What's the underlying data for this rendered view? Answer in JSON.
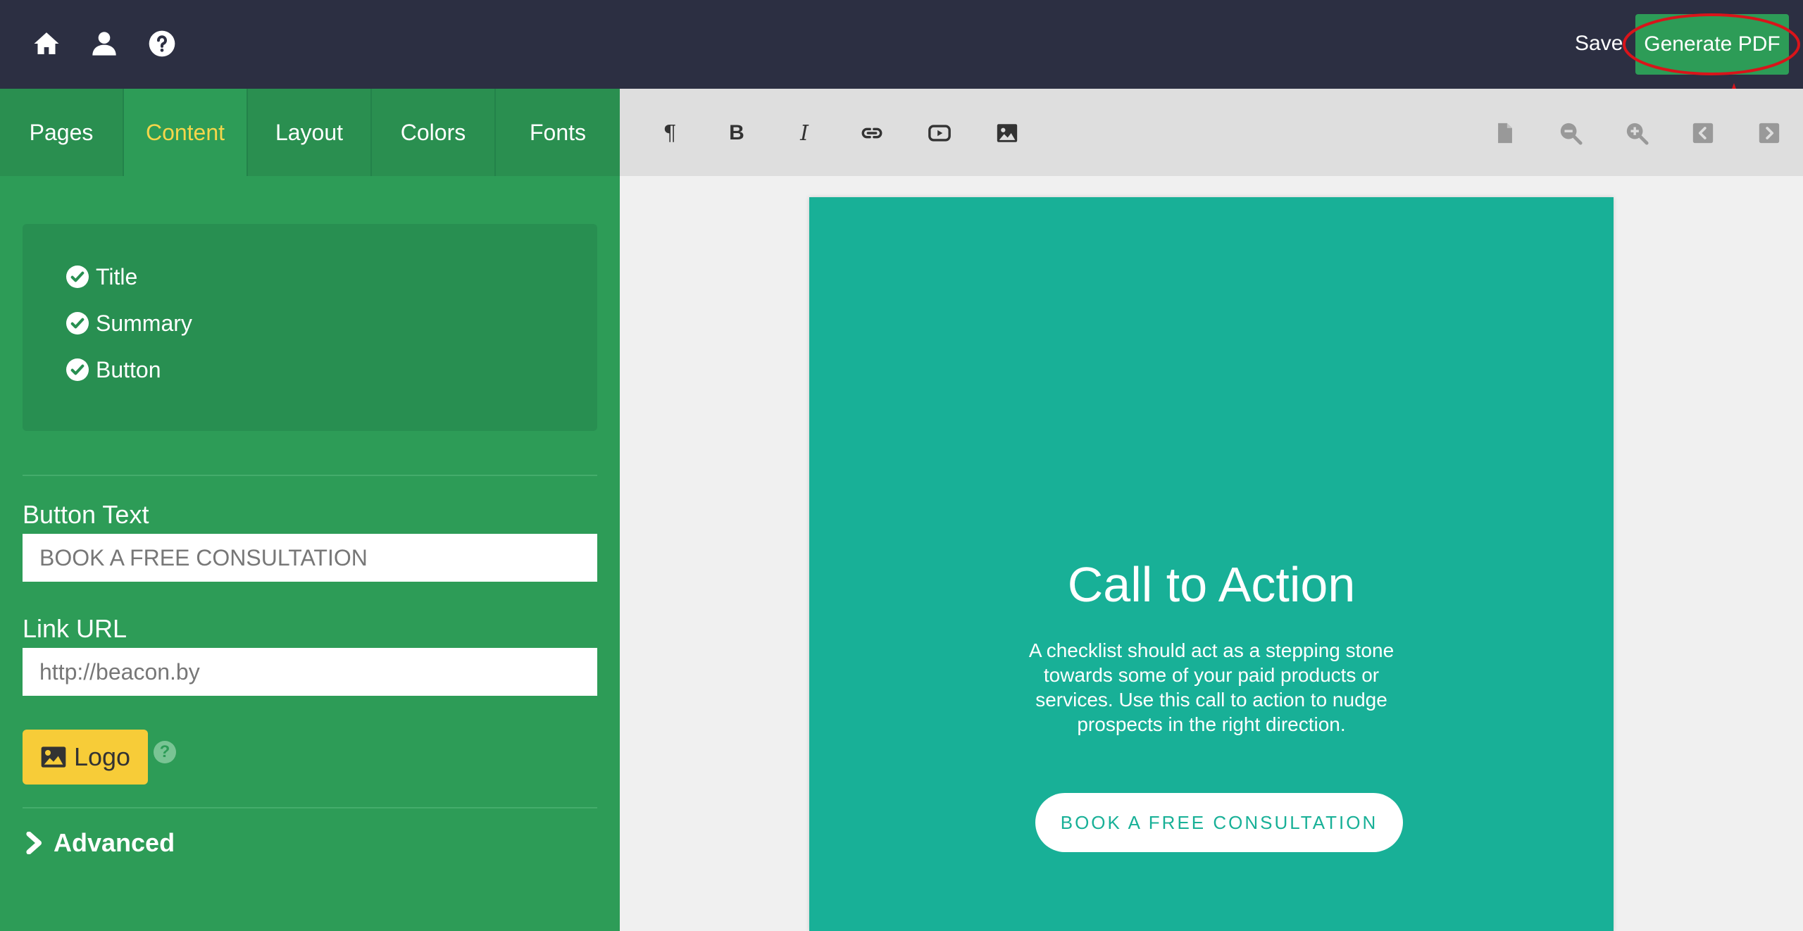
{
  "topbar": {
    "icons": [
      "home-icon",
      "user-icon",
      "help-icon"
    ],
    "save_label": "Save",
    "generate_label": "Generate PDF"
  },
  "tabs": [
    {
      "label": "Pages",
      "active": false
    },
    {
      "label": "Content",
      "active": true
    },
    {
      "label": "Layout",
      "active": false
    },
    {
      "label": "Colors",
      "active": false
    },
    {
      "label": "Fonts",
      "active": false
    }
  ],
  "sections": [
    {
      "label": "Title",
      "checked": true
    },
    {
      "label": "Summary",
      "checked": true
    },
    {
      "label": "Button",
      "checked": true
    }
  ],
  "button_text": {
    "label": "Button Text",
    "value": "BOOK A FREE CONSULTATION"
  },
  "link_url": {
    "label": "Link URL",
    "value": "http://beacon.by"
  },
  "logo_label": "Logo",
  "help_glyph": "?",
  "advanced_label": "Advanced",
  "toolbar": {
    "format_icons": [
      "paragraph-icon",
      "bold-icon",
      "italic-icon",
      "link-icon",
      "video-icon",
      "image-icon"
    ],
    "paragraph_glyph": "¶",
    "bold_glyph": "B",
    "italic_glyph": "I",
    "view_icons": [
      "page-icon",
      "zoom-out-icon",
      "zoom-in-icon",
      "prev-page-icon",
      "next-page-icon"
    ]
  },
  "page": {
    "title": "Call to Action",
    "summary": "A checklist should act as a stepping stone towards some of your paid products or services. Use this call to action to nudge prospects in the right direction.",
    "button_label": "BOOK A FREE CONSULTATION"
  },
  "colors": {
    "topbar": "#2c2f42",
    "panel_green": "#2d9c57",
    "active_tab_text": "#f5d64b",
    "page_teal": "#18b097",
    "logo_yellow": "#f7cc38",
    "annotation_red": "#d9141a"
  }
}
